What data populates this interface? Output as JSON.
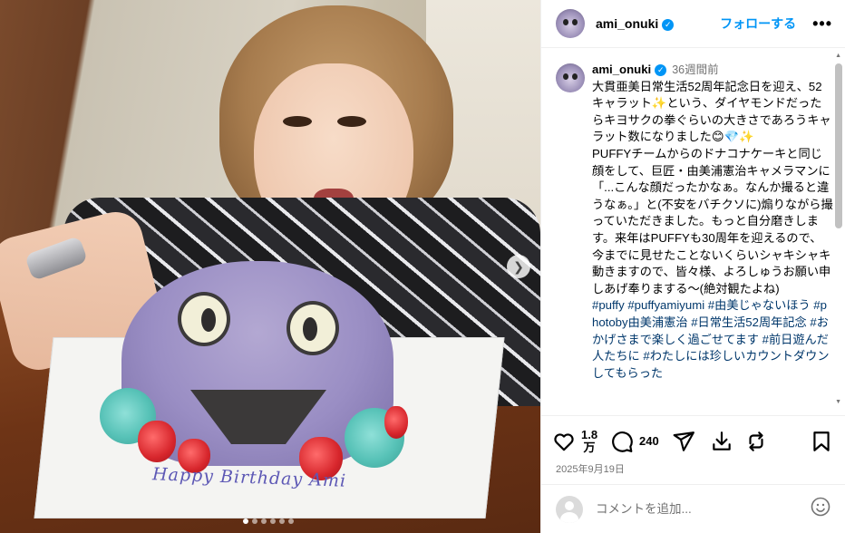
{
  "post": {
    "photo_alt": "photo",
    "cake_text": "Happy Birthday Ami",
    "carousel_count": 6,
    "carousel_active": 1
  },
  "header": {
    "username": "ami_onuki",
    "follow_label": "フォローする",
    "more_label": "•••"
  },
  "caption": {
    "username": "ami_onuki",
    "time": "36週間前",
    "text": "大貫亜美日常生活52周年記念日を迎え、52キャラット✨という、ダイヤモンドだったらキヨサクの拳ぐらいの大きさであろうキャラット数になりました😊💎✨\nPUFFYチームからのドナコナケーキと同じ顔をして、巨匠・由美浦憲治キャメラマンに「...こんな顔だったかなぁ。なんか撮ると違うなぁ。」と(不安をバチクソに)煽りながら撮っていただきました。もっと自分磨きします。来年はPUFFYも30周年を迎えるので、今までに見せたことないくらいシャキシャキ動きますので、皆々様、よろしゅうお願い申しあげ奉りまする〜(絶対観たよね)",
    "tags": "#puffy #puffyamiyumi #由美じゃないほう #photoby由美浦憲治 #日常生活52周年記念 #おかげさまで楽しく過ごせてます #前日遊んだ人たちに #わたしには珍しいカウントダウンしてもらった"
  },
  "actions": {
    "likes": "1.8\n万",
    "comments": "240",
    "date": "2025年9月19日"
  },
  "comment_box": {
    "placeholder": "コメントを追加..."
  },
  "colors": {
    "accent": "#0095f6",
    "hashtag": "#00376b",
    "muted": "#737373"
  },
  "icons": [
    "heart-icon",
    "comment-icon",
    "share-icon",
    "download-icon",
    "repost-icon",
    "bookmark-icon",
    "emoji-icon",
    "verified-icon",
    "more-icon",
    "chevron-right-icon"
  ]
}
